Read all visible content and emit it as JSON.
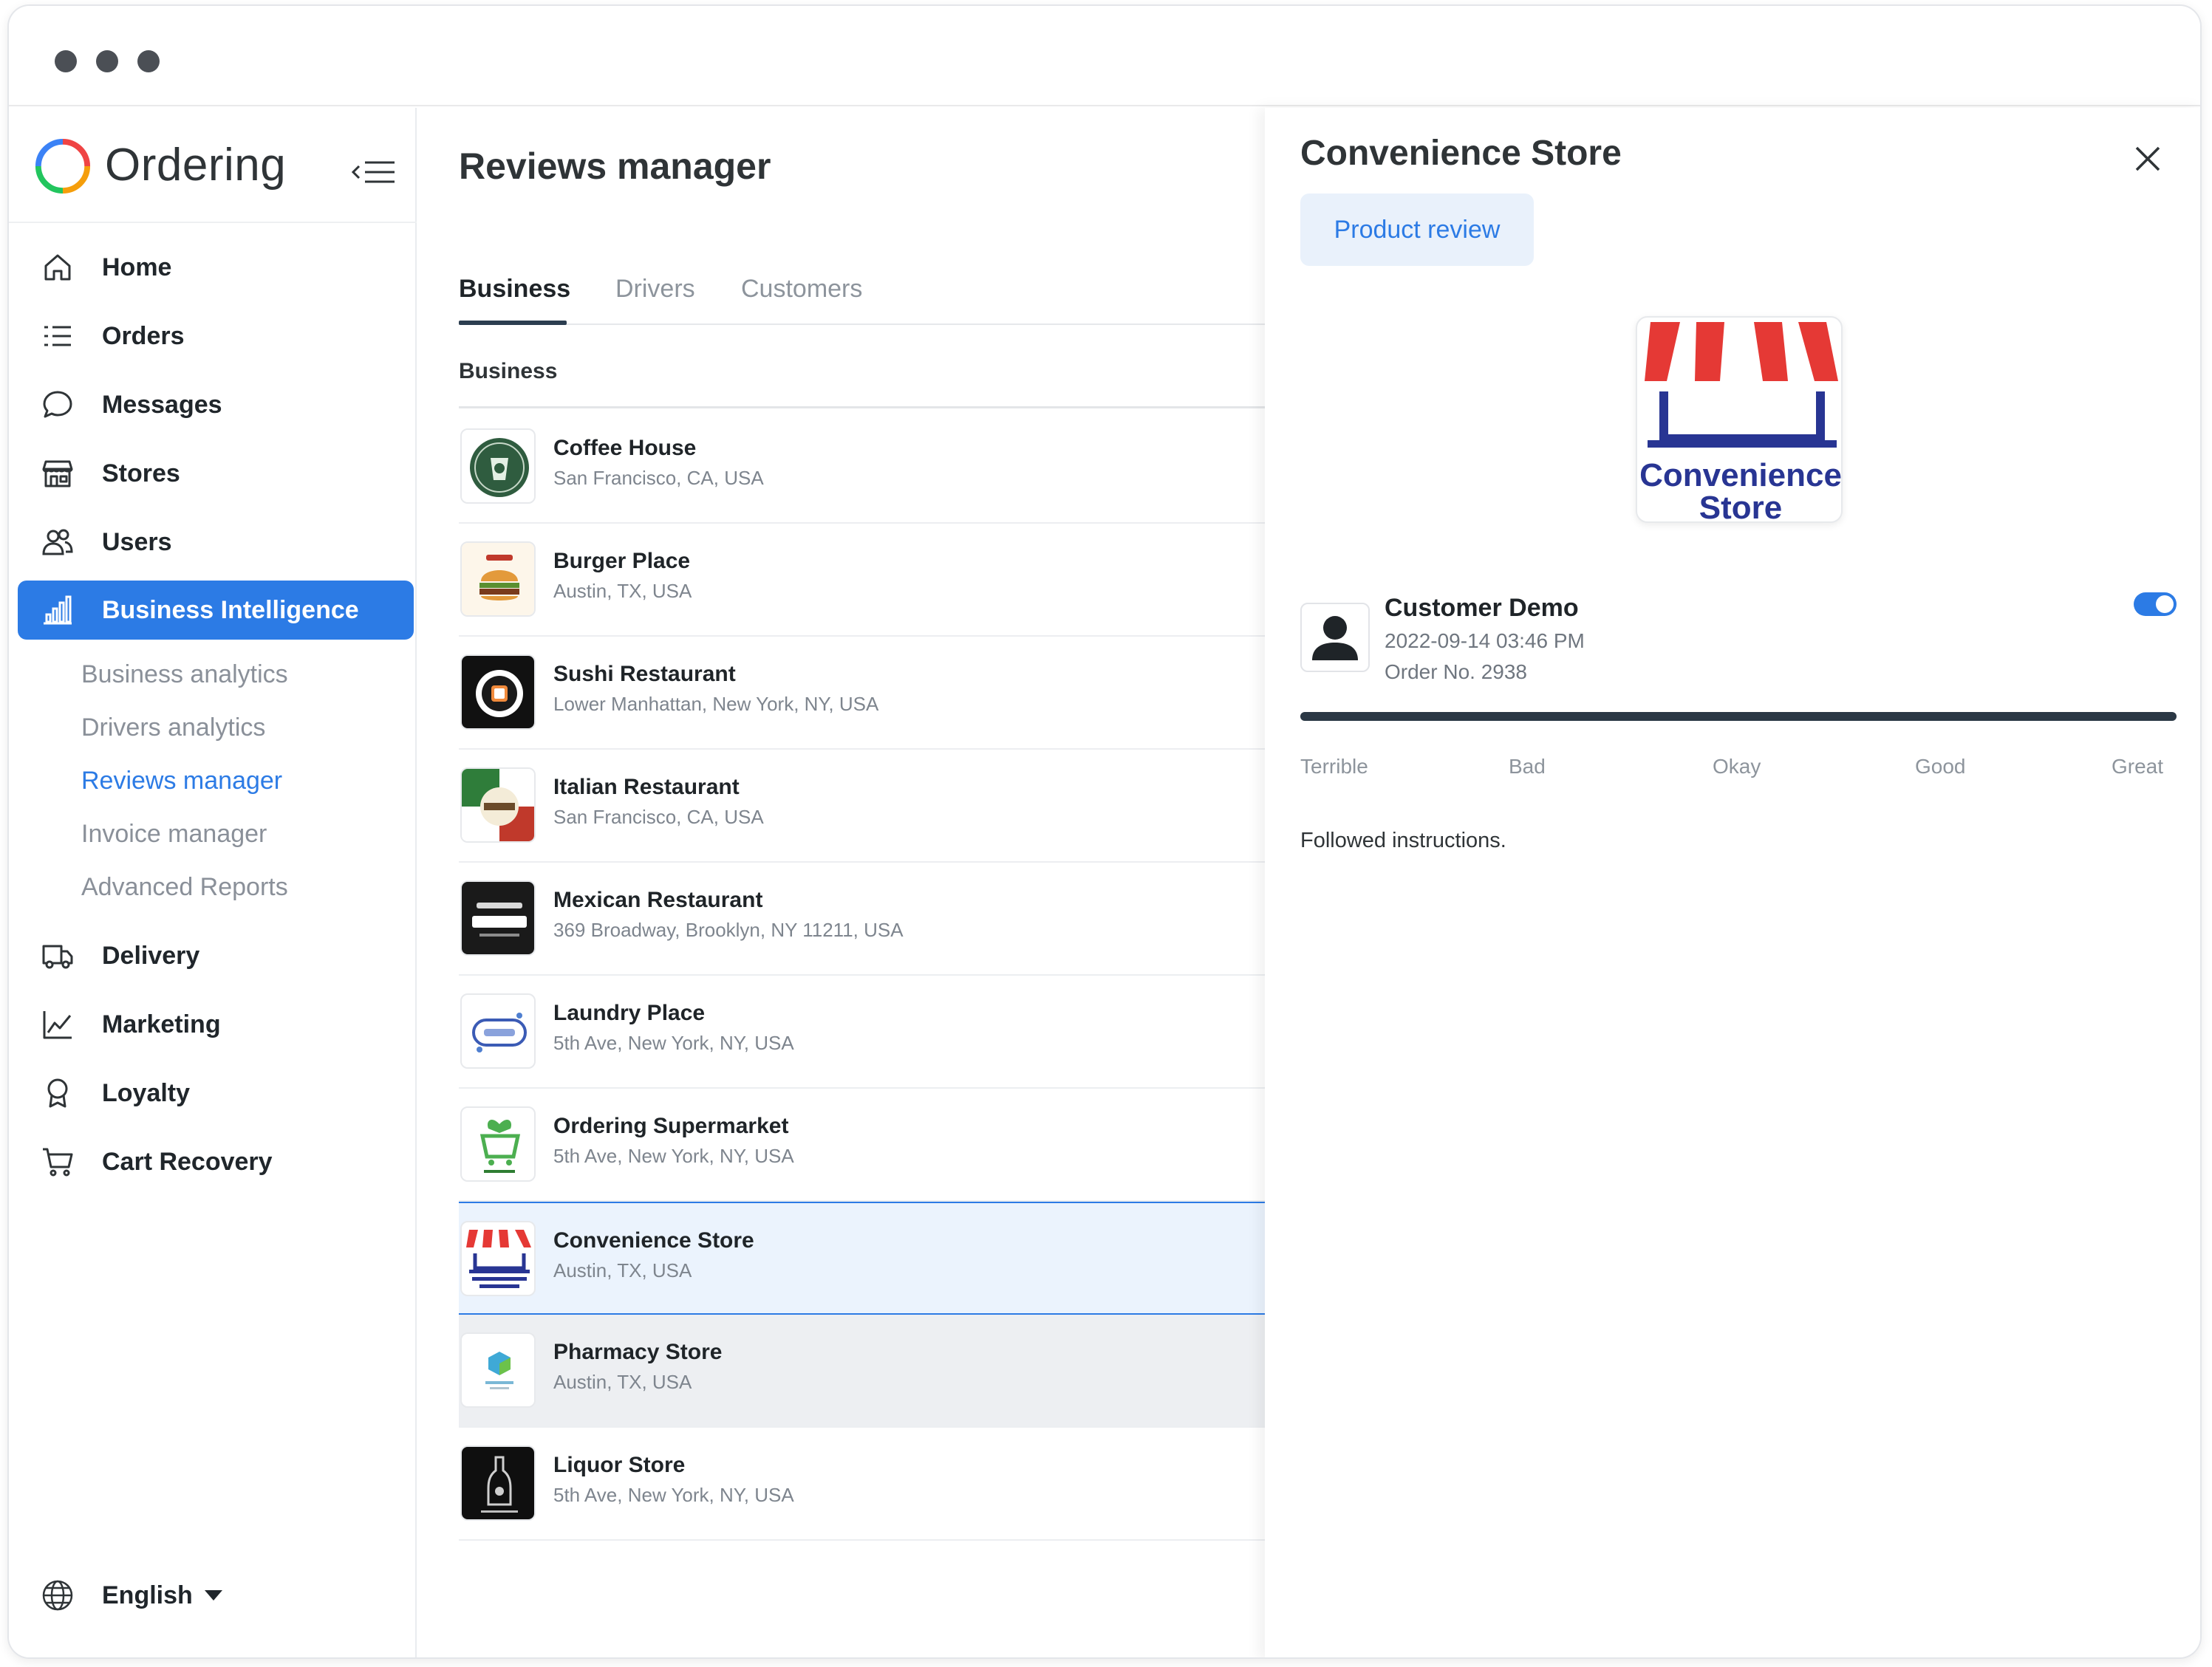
{
  "sidebar": {
    "brand": "Ordering",
    "nav": [
      {
        "label": "Home",
        "icon": "home-icon"
      },
      {
        "label": "Orders",
        "icon": "list-icon"
      },
      {
        "label": "Messages",
        "icon": "chat-bubble-icon"
      },
      {
        "label": "Stores",
        "icon": "storefront-icon"
      },
      {
        "label": "Users",
        "icon": "users-icon"
      },
      {
        "label": "Business Intelligence",
        "icon": "bar-chart-icon",
        "active": true
      }
    ],
    "sub_items": [
      {
        "label": "Business analytics"
      },
      {
        "label": "Drivers analytics"
      },
      {
        "label": "Reviews manager",
        "active": true
      },
      {
        "label": "Invoice manager"
      },
      {
        "label": "Advanced Reports"
      }
    ],
    "nav2": [
      {
        "label": "Delivery",
        "icon": "truck-icon"
      },
      {
        "label": "Marketing",
        "icon": "line-chart-icon"
      },
      {
        "label": "Loyalty",
        "icon": "award-icon"
      },
      {
        "label": "Cart Recovery",
        "icon": "cart-icon"
      }
    ],
    "language": "English"
  },
  "main": {
    "title": "Reviews manager",
    "tabs": [
      {
        "label": "Business",
        "active": true
      },
      {
        "label": "Drivers"
      },
      {
        "label": "Customers"
      }
    ],
    "table_header": "Business",
    "businesses": [
      {
        "name": "Coffee House",
        "address": "San Francisco, CA, USA"
      },
      {
        "name": "Burger Place",
        "address": "Austin, TX, USA"
      },
      {
        "name": "Sushi Restaurant",
        "address": "Lower Manhattan, New York, NY, USA"
      },
      {
        "name": "Italian Restaurant",
        "address": "San Francisco, CA, USA"
      },
      {
        "name": "Mexican Restaurant",
        "address": "369 Broadway, Brooklyn, NY 11211, USA"
      },
      {
        "name": "Laundry Place",
        "address": "5th Ave, New York, NY, USA"
      },
      {
        "name": "Ordering Supermarket",
        "address": "5th Ave, New York, NY, USA"
      },
      {
        "name": "Convenience Store",
        "address": "Austin, TX, USA",
        "selected": true
      },
      {
        "name": "Pharmacy Store",
        "address": "Austin, TX, USA",
        "hovered": true
      },
      {
        "name": "Liquor Store",
        "address": "5th Ave, New York, NY, USA"
      }
    ]
  },
  "panel": {
    "title": "Convenience Store",
    "pill": "Product review",
    "logo_text": [
      "Convenience",
      "Store"
    ],
    "review": {
      "customer": "Customer Demo",
      "date": "2022-09-14 03:46 PM",
      "order": "Order No. 2938",
      "enabled": true,
      "rating": 5,
      "rating_max": 5,
      "comment": "Followed instructions."
    },
    "rating_labels": [
      "Terrible",
      "Bad",
      "Okay",
      "Good",
      "Great"
    ]
  },
  "colors": {
    "accent": "#2c7be5",
    "selected_row": "#ebf3fd",
    "rating_fill": "#2b3845"
  }
}
